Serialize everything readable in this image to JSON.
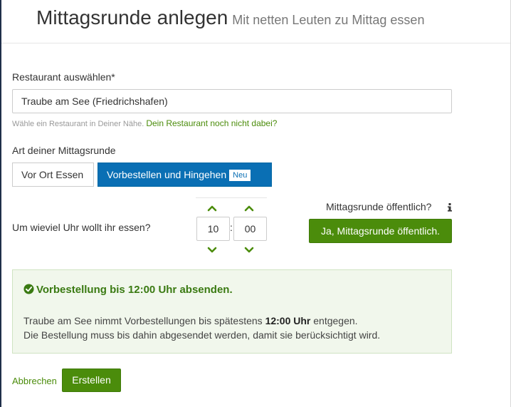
{
  "header": {
    "title": "Mittagsrunde anlegen",
    "subtitle": "Mit netten Leuten zu Mittag essen"
  },
  "restaurant": {
    "label": "Restaurant auswählen*",
    "value": "Traube am See (Friedrichshafen)",
    "help_text": "Wähle ein Restaurant in Deiner Nähe.",
    "help_link": "Dein Restaurant noch nicht dabei?"
  },
  "type": {
    "label": "Art deiner Mittagsrunde",
    "option_onsite": "Vor Ort Essen",
    "option_preorder": "Vorbestellen und Hingehen",
    "new_badge": "Neu",
    "selected": "Vorbestellen und Hingehen"
  },
  "time": {
    "label": "Um wieviel Uhr wollt ihr essen?",
    "hour": "10",
    "separator": ":",
    "minute": "00"
  },
  "public": {
    "label": "Mittagsrunde öffentlich?",
    "button": "Ja, Mittagsrunde öffentlich."
  },
  "alert": {
    "title": "Vorbestellung bis 12:00 Uhr absenden.",
    "line1_prefix": "Traube am See nimmt Vorbestellungen bis spätestens",
    "line1_bold": "12:00 Uhr",
    "line1_suffix": "entgegen.",
    "line2": "Die Bestellung muss bis dahin abgesendet werden, damit sie berücksichtigt wird."
  },
  "actions": {
    "cancel": "Abbrechen",
    "create": "Erstellen"
  },
  "colors": {
    "accent_green": "#4b8c0b",
    "accent_blue": "#0a6fb4",
    "alert_bg": "#f1f7ec"
  }
}
